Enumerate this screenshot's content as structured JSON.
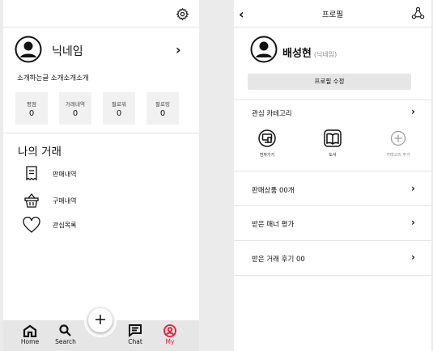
{
  "my_page": {
    "nickname": "닉네임",
    "intro": "소개하는글 소개소개소개",
    "stats": [
      {
        "label": "평점",
        "value": "0"
      },
      {
        "label": "거래내역",
        "value": "0"
      },
      {
        "label": "팔로워",
        "value": "0"
      },
      {
        "label": "팔로잉",
        "value": "0"
      }
    ],
    "section_title": "나의 거래",
    "menu": [
      {
        "label": "판매내역",
        "icon": "receipt-icon"
      },
      {
        "label": "구매내역",
        "icon": "basket-icon"
      },
      {
        "label": "관심목록",
        "icon": "heart-icon"
      }
    ],
    "tabbar": {
      "home": "Home",
      "search": "Search",
      "plus": "+",
      "chat": "Chat",
      "my": "My"
    }
  },
  "profile_page": {
    "back": "‹",
    "title": "프로필",
    "name": "배성현",
    "nickname": "(닉네임)",
    "edit_button": "프로필 수정",
    "interest_title": "관심 카테고리",
    "categories": [
      {
        "label": "전자기기",
        "icon": "electronics-icon"
      },
      {
        "label": "도서",
        "icon": "book-icon"
      },
      {
        "label": "카테고리 추가",
        "icon": "add-circle-icon"
      }
    ],
    "rows": [
      {
        "label": "판매상품 00개"
      },
      {
        "label": "받은 매너 평가"
      },
      {
        "label": "받은 거래 후기 00"
      }
    ],
    "chevron": "›"
  },
  "colors": {
    "accent": "#e8192c",
    "tabbar_bg": "#e6e6e6",
    "stat_bg": "#f1f1f1",
    "button_bg": "#e6e6e6"
  }
}
